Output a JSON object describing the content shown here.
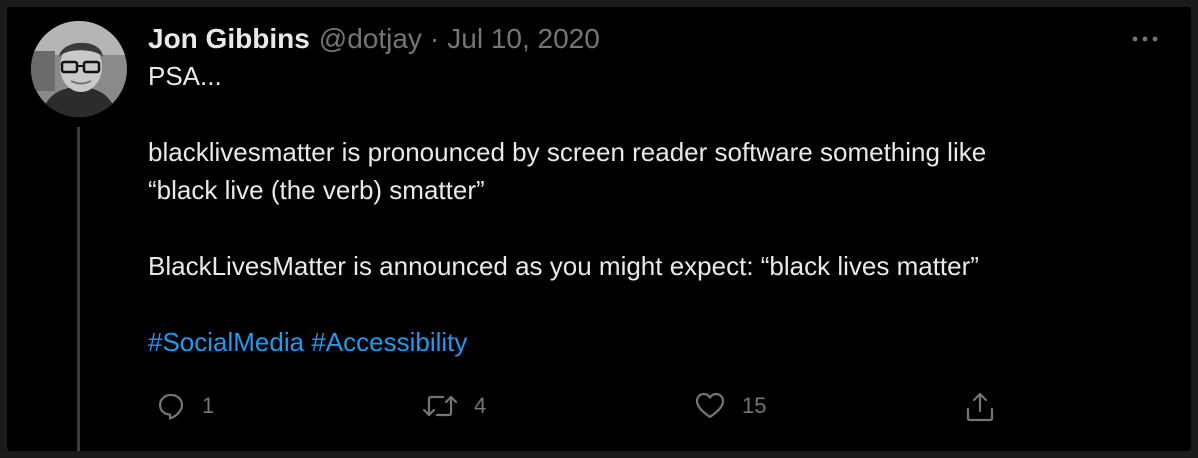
{
  "author": {
    "display_name": "Jon Gibbins",
    "handle": "@dotjay",
    "separator": "·",
    "date": "Jul 10, 2020"
  },
  "tweet": {
    "paragraphs": [
      "PSA...",
      "",
      "blacklivesmatter is pronounced by screen reader software something like",
      "“black live (the verb) smatter”",
      "",
      "BlackLivesMatter is announced as you might expect: “black lives matter”",
      ""
    ],
    "hashtags": [
      "#SocialMedia",
      "#Accessibility"
    ]
  },
  "actions": {
    "reply_count": "1",
    "retweet_count": "4",
    "like_count": "15"
  },
  "icons": {
    "reply": "reply-icon",
    "retweet": "retweet-icon",
    "like": "heart-icon",
    "share": "share-icon",
    "more": "more-icon"
  },
  "colors": {
    "background": "#000000",
    "text": "#e7e9ea",
    "muted": "#71767b",
    "link": "#1d9bf0",
    "thread_line": "#3a3d40"
  }
}
